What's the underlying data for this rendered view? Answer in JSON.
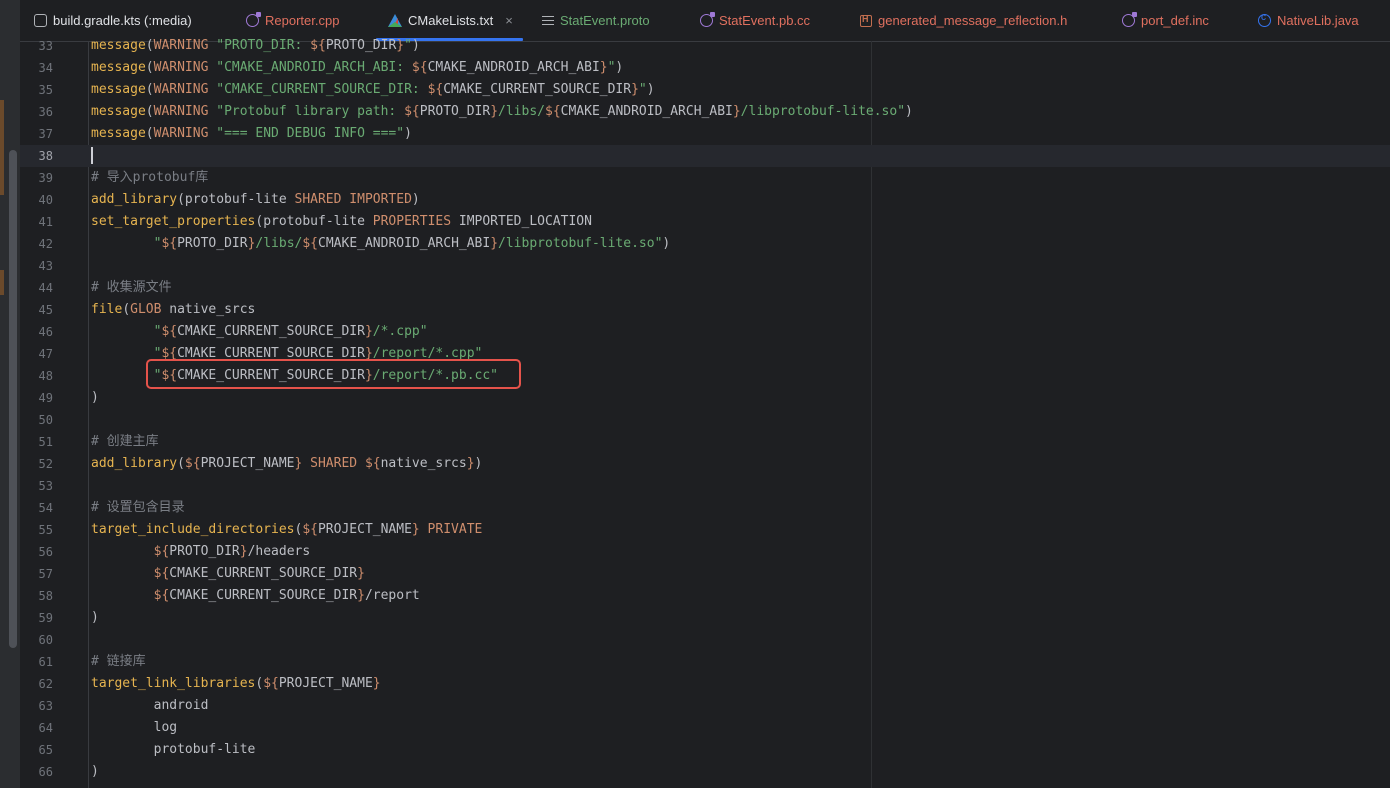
{
  "tabs": [
    {
      "label": "build.gradle.kts (:media)",
      "icon": "gradle-icon",
      "color": "#dfe1e5"
    },
    {
      "label": "Reporter.cpp",
      "icon": "cpp-file-icon",
      "color": "#e0705f"
    },
    {
      "label": "CMakeLists.txt",
      "icon": "cmake-icon",
      "color": "#dfe1e5",
      "active": true,
      "close": "×"
    },
    {
      "label": "StatEvent.proto",
      "icon": "text-file-icon",
      "color": "#6aab73"
    },
    {
      "label": "StatEvent.pb.cc",
      "icon": "cpp-file-icon",
      "color": "#e0705f"
    },
    {
      "label": "generated_message_reflection.h",
      "icon": "header-file-icon",
      "color": "#e0705f"
    },
    {
      "label": "port_def.inc",
      "icon": "cpp-file-icon",
      "color": "#e0705f"
    },
    {
      "label": "NativeLib.java",
      "icon": "java-class-icon",
      "color": "#e0705f"
    }
  ],
  "editor": {
    "current_line": 38,
    "lines": [
      {
        "n": 33,
        "t": [
          [
            "fn",
            "message"
          ],
          [
            "var",
            "("
          ],
          [
            "kw",
            "WARNING "
          ],
          [
            "str",
            "\"PROTO_DIR: "
          ],
          [
            "kw",
            "${"
          ],
          [
            "var",
            "PROTO_DIR"
          ],
          [
            "kw",
            "}"
          ],
          [
            "str",
            "\""
          ],
          [
            "var",
            ")"
          ]
        ]
      },
      {
        "n": 34,
        "t": [
          [
            "fn",
            "message"
          ],
          [
            "var",
            "("
          ],
          [
            "kw",
            "WARNING "
          ],
          [
            "str",
            "\"CMAKE_ANDROID_ARCH_ABI: "
          ],
          [
            "kw",
            "${"
          ],
          [
            "var",
            "CMAKE_ANDROID_ARCH_ABI"
          ],
          [
            "kw",
            "}"
          ],
          [
            "str",
            "\""
          ],
          [
            "var",
            ")"
          ]
        ]
      },
      {
        "n": 35,
        "t": [
          [
            "fn",
            "message"
          ],
          [
            "var",
            "("
          ],
          [
            "kw",
            "WARNING "
          ],
          [
            "str",
            "\"CMAKE_CURRENT_SOURCE_DIR: "
          ],
          [
            "kw",
            "${"
          ],
          [
            "var",
            "CMAKE_CURRENT_SOURCE_DIR"
          ],
          [
            "kw",
            "}"
          ],
          [
            "str",
            "\""
          ],
          [
            "var",
            ")"
          ]
        ]
      },
      {
        "n": 36,
        "t": [
          [
            "fn",
            "message"
          ],
          [
            "var",
            "("
          ],
          [
            "kw",
            "WARNING "
          ],
          [
            "str",
            "\"Protobuf library path: "
          ],
          [
            "kw",
            "${"
          ],
          [
            "var",
            "PROTO_DIR"
          ],
          [
            "kw",
            "}"
          ],
          [
            "str",
            "/libs/"
          ],
          [
            "kw",
            "${"
          ],
          [
            "var",
            "CMAKE_ANDROID_ARCH_ABI"
          ],
          [
            "kw",
            "}"
          ],
          [
            "str",
            "/libprotobuf-lite.so\""
          ],
          [
            "var",
            ")"
          ]
        ]
      },
      {
        "n": 37,
        "t": [
          [
            "fn",
            "message"
          ],
          [
            "var",
            "("
          ],
          [
            "kw",
            "WARNING "
          ],
          [
            "str",
            "\"=== END DEBUG INFO ===\""
          ],
          [
            "var",
            ")"
          ]
        ]
      },
      {
        "n": 38,
        "t": []
      },
      {
        "n": 39,
        "t": [
          [
            "cmt",
            "# 导入protobuf库"
          ]
        ]
      },
      {
        "n": 40,
        "t": [
          [
            "fn",
            "add_library"
          ],
          [
            "var",
            "(protobuf-lite "
          ],
          [
            "kw",
            "SHARED IMPORTED"
          ],
          [
            "var",
            ")"
          ]
        ]
      },
      {
        "n": 41,
        "t": [
          [
            "fn",
            "set_target_properties"
          ],
          [
            "var",
            "(protobuf-lite "
          ],
          [
            "kw",
            "PROPERTIES "
          ],
          [
            "var",
            "IMPORTED_LOCATION"
          ]
        ]
      },
      {
        "n": 42,
        "t": [
          [
            "var",
            "        "
          ],
          [
            "str",
            "\""
          ],
          [
            "kw",
            "${"
          ],
          [
            "var",
            "PROTO_DIR"
          ],
          [
            "kw",
            "}"
          ],
          [
            "str",
            "/libs/"
          ],
          [
            "kw",
            "${"
          ],
          [
            "var",
            "CMAKE_ANDROID_ARCH_ABI"
          ],
          [
            "kw",
            "}"
          ],
          [
            "str",
            "/libprotobuf-lite.so\""
          ],
          [
            "var",
            ")"
          ]
        ]
      },
      {
        "n": 43,
        "t": []
      },
      {
        "n": 44,
        "t": [
          [
            "cmt",
            "# 收集源文件"
          ]
        ]
      },
      {
        "n": 45,
        "t": [
          [
            "fn",
            "file"
          ],
          [
            "var",
            "("
          ],
          [
            "kw",
            "GLOB "
          ],
          [
            "var",
            "native_srcs"
          ]
        ]
      },
      {
        "n": 46,
        "t": [
          [
            "var",
            "        "
          ],
          [
            "str",
            "\""
          ],
          [
            "kw",
            "${"
          ],
          [
            "var",
            "CMAKE_CURRENT_SOURCE_DIR"
          ],
          [
            "kw",
            "}"
          ],
          [
            "str",
            "/*.cpp\""
          ]
        ]
      },
      {
        "n": 47,
        "t": [
          [
            "var",
            "        "
          ],
          [
            "str",
            "\""
          ],
          [
            "kw",
            "${"
          ],
          [
            "var",
            "CMAKE_CURRENT_SOURCE_DIR"
          ],
          [
            "kw",
            "}"
          ],
          [
            "str",
            "/report/*.cpp\""
          ]
        ]
      },
      {
        "n": 48,
        "t": [
          [
            "var",
            "        "
          ],
          [
            "str",
            "\""
          ],
          [
            "kw",
            "${"
          ],
          [
            "var",
            "CMAKE_CURRENT_SOURCE_DIR"
          ],
          [
            "kw",
            "}"
          ],
          [
            "str",
            "/report/*.pb.cc\""
          ]
        ]
      },
      {
        "n": 49,
        "t": [
          [
            "var",
            ")"
          ]
        ]
      },
      {
        "n": 50,
        "t": []
      },
      {
        "n": 51,
        "t": [
          [
            "cmt",
            "# 创建主库"
          ]
        ]
      },
      {
        "n": 52,
        "t": [
          [
            "fn",
            "add_library"
          ],
          [
            "var",
            "("
          ],
          [
            "kw",
            "${"
          ],
          [
            "var",
            "PROJECT_NAME"
          ],
          [
            "kw",
            "}"
          ],
          [
            "kw",
            " SHARED "
          ],
          [
            "kw",
            "${"
          ],
          [
            "var",
            "native_srcs"
          ],
          [
            "kw",
            "}"
          ],
          [
            "var",
            ")"
          ]
        ]
      },
      {
        "n": 53,
        "t": []
      },
      {
        "n": 54,
        "t": [
          [
            "cmt",
            "# 设置包含目录"
          ]
        ]
      },
      {
        "n": 55,
        "t": [
          [
            "fn",
            "target_include_directories"
          ],
          [
            "var",
            "("
          ],
          [
            "kw",
            "${"
          ],
          [
            "var",
            "PROJECT_NAME"
          ],
          [
            "kw",
            "}"
          ],
          [
            "kw",
            " PRIVATE"
          ]
        ]
      },
      {
        "n": 56,
        "t": [
          [
            "var",
            "        "
          ],
          [
            "kw",
            "${"
          ],
          [
            "var",
            "PROTO_DIR"
          ],
          [
            "kw",
            "}"
          ],
          [
            "var",
            "/headers"
          ]
        ]
      },
      {
        "n": 57,
        "t": [
          [
            "var",
            "        "
          ],
          [
            "kw",
            "${"
          ],
          [
            "var",
            "CMAKE_CURRENT_SOURCE_DIR"
          ],
          [
            "kw",
            "}"
          ]
        ]
      },
      {
        "n": 58,
        "t": [
          [
            "var",
            "        "
          ],
          [
            "kw",
            "${"
          ],
          [
            "var",
            "CMAKE_CURRENT_SOURCE_DIR"
          ],
          [
            "kw",
            "}"
          ],
          [
            "var",
            "/report"
          ]
        ]
      },
      {
        "n": 59,
        "t": [
          [
            "var",
            ")"
          ]
        ]
      },
      {
        "n": 60,
        "t": []
      },
      {
        "n": 61,
        "t": [
          [
            "cmt",
            "# 链接库"
          ]
        ]
      },
      {
        "n": 62,
        "t": [
          [
            "fn",
            "target_link_libraries"
          ],
          [
            "var",
            "("
          ],
          [
            "kw",
            "${"
          ],
          [
            "var",
            "PROJECT_NAME"
          ],
          [
            "kw",
            "}"
          ]
        ]
      },
      {
        "n": 63,
        "t": [
          [
            "var",
            "        android"
          ]
        ]
      },
      {
        "n": 64,
        "t": [
          [
            "var",
            "        log"
          ]
        ]
      },
      {
        "n": 65,
        "t": [
          [
            "var",
            "        protobuf-lite"
          ]
        ]
      },
      {
        "n": 66,
        "t": [
          [
            "var",
            ")"
          ]
        ]
      }
    ]
  },
  "colors": {
    "background": "#1e1f22",
    "active_tab_underline": "#3574f0",
    "highlight_box": "#e5534b"
  }
}
